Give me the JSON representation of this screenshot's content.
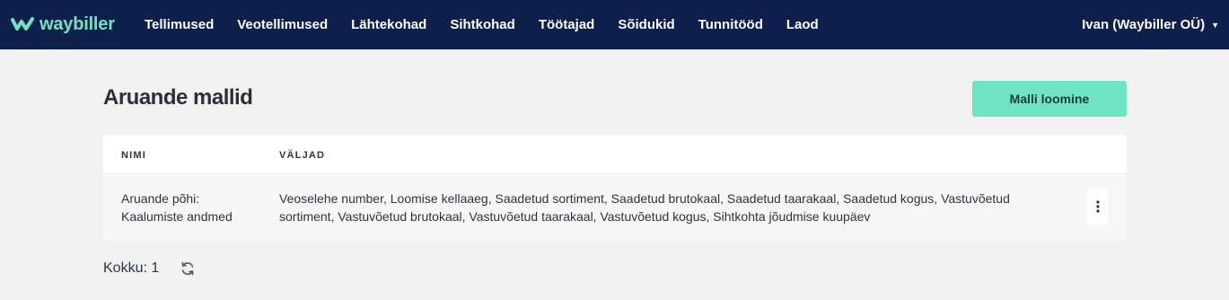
{
  "brand": {
    "name": "waybiller",
    "accent": "#6fe4c2",
    "navbar_bg": "#0f1f4b"
  },
  "nav": {
    "items": [
      "Tellimused",
      "Veotellimused",
      "Lähtekohad",
      "Sihtkohad",
      "Töötajad",
      "Sõidukid",
      "Tunnitööd",
      "Laod"
    ],
    "user": "Ivan (Waybiller OÜ)"
  },
  "page": {
    "title": "Aruande mallid",
    "create_button": "Malli loomine"
  },
  "table": {
    "columns": [
      "NIMI",
      "VÄLJAD"
    ],
    "rows": [
      {
        "name": "Aruande põhi: Kaalumiste andmed",
        "fields": "Veoselehe number, Loomise kellaaeg, Saadetud sortiment, Saadetud brutokaal, Saadetud taarakaal, Saadetud kogus, Vastuvõetud sortiment, Vastuvõetud brutokaal, Vastuvõetud taarakaal, Vastuvõetud kogus, Sihtkohta jõudmise kuupäev"
      }
    ]
  },
  "footer": {
    "total": "Kokku: 1"
  },
  "icons": [
    "waybiller-logo-icon",
    "caret-down-icon",
    "kebab-menu-icon",
    "refresh-icon"
  ]
}
